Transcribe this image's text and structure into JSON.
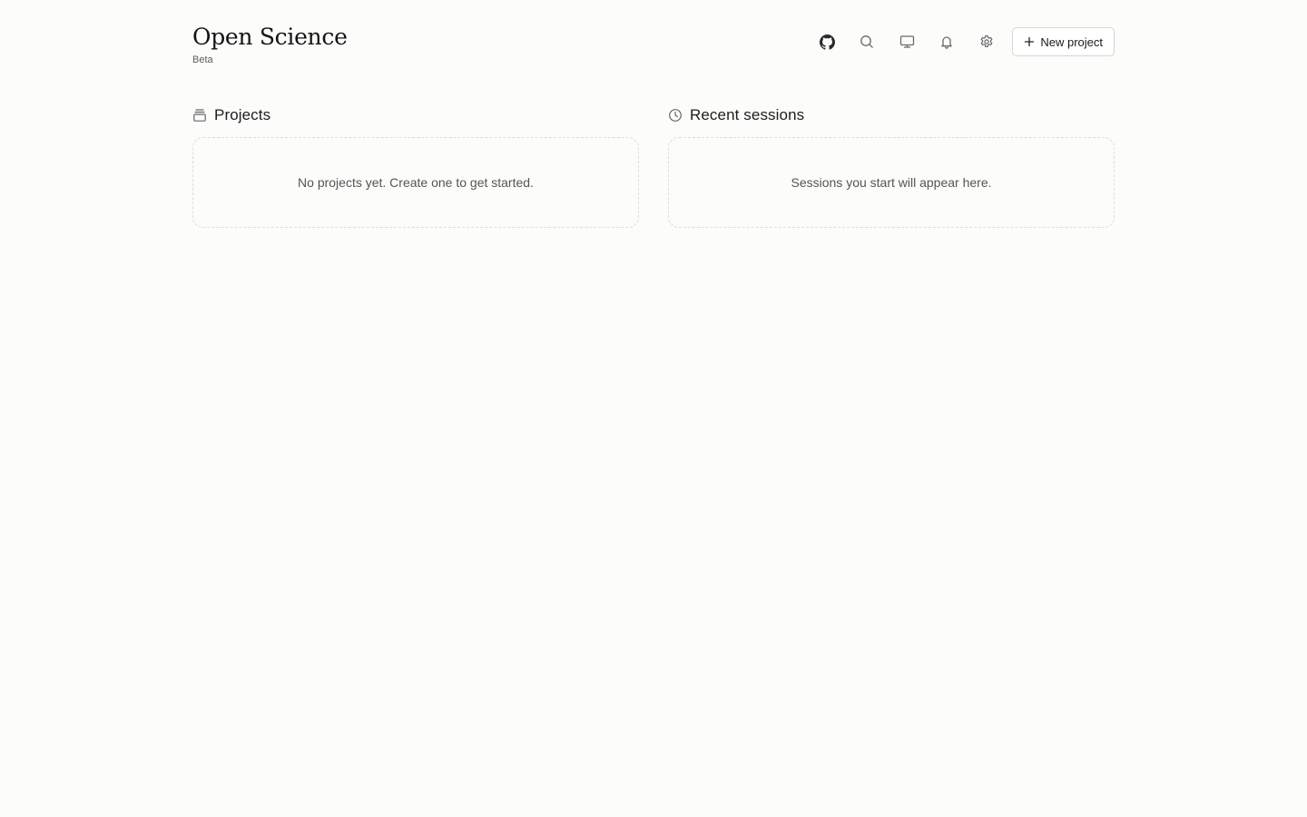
{
  "header": {
    "title": "Open Science",
    "subtitle": "Beta"
  },
  "toolbar": {
    "icons": [
      "github-icon",
      "search-icon",
      "monitor-icon",
      "bell-icon",
      "gear-icon"
    ],
    "new_project_label": "New project"
  },
  "projects": {
    "title": "Projects",
    "icon": "archive-icon",
    "empty_text": "No projects yet. Create one to get started."
  },
  "sessions": {
    "title": "Recent sessions",
    "icon": "clock-icon",
    "empty_text": "Sessions you start will appear here."
  },
  "colors": {
    "background": "#fcfcfb",
    "text": "#1c1c1c",
    "muted": "#555555",
    "border": "#dddddb"
  }
}
